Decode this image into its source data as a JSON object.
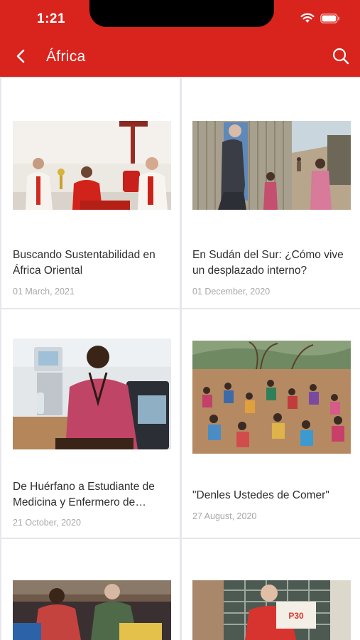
{
  "status_bar": {
    "time": "1:21"
  },
  "nav": {
    "title": "África"
  },
  "articles": [
    {
      "title": "Buscando Sustentabilidad en África Oriental",
      "date": "01 March, 2021"
    },
    {
      "title": "En Sudán del Sur: ¿Cómo vive un desplazado interno?",
      "date": "01 December, 2020"
    },
    {
      "title": "De Huérfano a Estudiante de Medicina y Enfermero de Ciudad...",
      "date": "21 October, 2020"
    },
    {
      "title": "\"Denles Ustedes de Comer\"",
      "date": "27 August, 2020"
    },
    {
      "title": "",
      "date": ""
    },
    {
      "title": "",
      "date": ""
    }
  ],
  "colors": {
    "header": "#d9231d",
    "divider": "#e7e6ee",
    "title_text": "#2e2e2e",
    "date_text": "#a8a8ac"
  }
}
